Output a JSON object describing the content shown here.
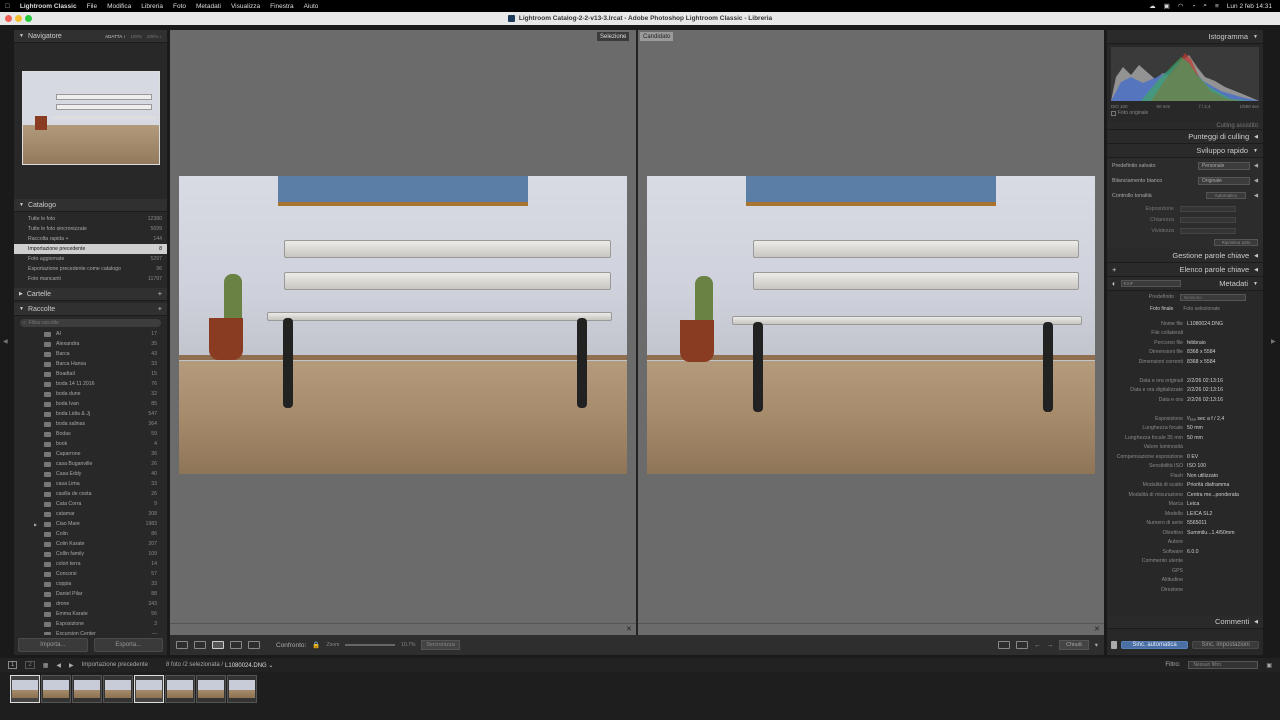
{
  "menubar": {
    "app": "Lightroom Classic",
    "items": [
      "File",
      "Modifica",
      "Libreria",
      "Foto",
      "Metadati",
      "Visualizza",
      "Finestra",
      "Aiuto"
    ],
    "clock": "Lun 2 feb  14:31"
  },
  "window": {
    "title": "Lightroom Catalog-2-2-v13-3.lrcat - Adobe Photoshop Lightroom Classic - Libreria"
  },
  "navigator": {
    "title": "Navigatore",
    "zoom": [
      "ADATTA ↕",
      "100%",
      "200% ↕"
    ]
  },
  "catalog": {
    "title": "Catalogo",
    "items": [
      {
        "label": "Tutte le foto",
        "count": "12380"
      },
      {
        "label": "Tutte le foto sincronizzate",
        "count": "5699"
      },
      {
        "label": "Raccolta rapida +",
        "count": "144"
      },
      {
        "label": "Importazione precedente",
        "count": "8"
      },
      {
        "label": "Foto aggiornate",
        "count": "5297"
      },
      {
        "label": "Esportazione precedente come catalogo",
        "count": "96"
      },
      {
        "label": "Foto mancanti",
        "count": "11797"
      }
    ]
  },
  "folders": {
    "title": "Cartelle"
  },
  "collections": {
    "title": "Raccolte",
    "search_placeholder": "Filtra raccolte",
    "items": [
      {
        "label": "AI",
        "count": "17"
      },
      {
        "label": "Alexandra",
        "count": "35"
      },
      {
        "label": "Barca",
        "count": "43"
      },
      {
        "label": "Barca Hansa",
        "count": "33"
      },
      {
        "label": "Boadtail",
        "count": "15"
      },
      {
        "label": "boda 14 11 2016",
        "count": "76"
      },
      {
        "label": "boda dune",
        "count": "32"
      },
      {
        "label": "boda Ivan",
        "count": "85"
      },
      {
        "label": "boda Lidia & Jj",
        "count": "547"
      },
      {
        "label": "boda salinas",
        "count": "364"
      },
      {
        "label": "Bodas",
        "count": "59"
      },
      {
        "label": "book",
        "count": "4"
      },
      {
        "label": "Caparrone",
        "count": "36"
      },
      {
        "label": "casa Buganville",
        "count": "26"
      },
      {
        "label": "Casa Eddy",
        "count": "40"
      },
      {
        "label": "casa Lima",
        "count": "33"
      },
      {
        "label": "casilla de costa",
        "count": "26"
      },
      {
        "label": "Cata Corra",
        "count": "9"
      },
      {
        "label": "catamar",
        "count": "308"
      },
      {
        "label": "Ciao Mare",
        "count": "1983"
      },
      {
        "label": "Colin",
        "count": "86"
      },
      {
        "label": "Colin Karate",
        "count": "207"
      },
      {
        "label": "Collin family",
        "count": "109"
      },
      {
        "label": "colori terra",
        "count": "14"
      },
      {
        "label": "Concorsi",
        "count": "57"
      },
      {
        "label": "coppia",
        "count": "33"
      },
      {
        "label": "Daniel Pilar",
        "count": "88"
      },
      {
        "label": "drone",
        "count": "343"
      },
      {
        "label": "Emma Karate",
        "count": "56"
      },
      {
        "label": "Esposizione",
        "count": "3"
      },
      {
        "label": "Excursion Center",
        "count": "—"
      }
    ]
  },
  "left_buttons": {
    "import": "Importa...",
    "export": "Esporta..."
  },
  "compare": {
    "select_label": "Selezione",
    "candidate_label": "Candidato"
  },
  "toolbar": {
    "compare_label": "Confronto:",
    "zoom_label": "Zoom",
    "zoom_value": "10.7%",
    "sync_label": "Sincronizza",
    "done_label": "Chiudi"
  },
  "histogram": {
    "title": "Istogramma",
    "iso": "ISO 100",
    "focal": "50 mm",
    "aperture": "f / 2,4",
    "shutter": "1/500 sec",
    "original_label": "Foto originale"
  },
  "right_sections": {
    "assisted": "Culling assistito",
    "culling": "Punteggi di culling",
    "quick": "Sviluppo rapido",
    "keyword_mgmt": "Gestione parole chiave",
    "keyword_list": "Elenco parole chiave",
    "metadata": "Metadati",
    "comments": "Commenti"
  },
  "quick_develop": {
    "preset_label": "Predefinito salvato",
    "preset_value": "Personale",
    "wb_label": "Bilanciamento bianco",
    "wb_value": "Originale",
    "tone_label": "Controllo tonalità",
    "tone_value": "Automatico",
    "exposure": "Esposizione",
    "clarity": "Chiarezza",
    "vibrance": "Vividezza",
    "reset": "Ripristina tutto"
  },
  "metadata_head": {
    "preset_label": "Predefinito",
    "preset_value": "Nessuno",
    "exif": "EXIF",
    "tab1": "Foto finale",
    "tab2": "Foto selezionate"
  },
  "metadata": [
    {
      "k": "Nome file",
      "v": "L1080024.DNG"
    },
    {
      "k": "File collaterali",
      "v": ""
    },
    {
      "k": "Percorso file",
      "v": "febbraio"
    },
    {
      "k": "Dimensioni file",
      "v": "8368 x 5584"
    },
    {
      "k": "Dimensioni correnti",
      "v": "8368 x 5584"
    },
    {
      "k": "",
      "v": ""
    },
    {
      "k": "Data e ora originali",
      "v": "2/2/26 02:13:16"
    },
    {
      "k": "Data e ora digitalizzate",
      "v": "2/2/26 02:13:16"
    },
    {
      "k": "Data e ora",
      "v": "2/2/26 02:13:16"
    },
    {
      "k": "",
      "v": ""
    },
    {
      "k": "Esposizione",
      "v": "¹⁄₅₀₀ sec a f / 2,4"
    },
    {
      "k": "Lunghezza focale",
      "v": "50 mm"
    },
    {
      "k": "Lunghezza focale 35 mm",
      "v": "50 mm"
    },
    {
      "k": "Valore luminosità",
      "v": ""
    },
    {
      "k": "Compensazione esposizione",
      "v": "0 EV"
    },
    {
      "k": "Sensibilità ISO",
      "v": "ISO 100"
    },
    {
      "k": "Flash",
      "v": "Non utilizzato"
    },
    {
      "k": "Modalità di scatto",
      "v": "Priorità diaframma"
    },
    {
      "k": "Modalità di misurazione",
      "v": "Centra me...ponderata"
    },
    {
      "k": "Marca",
      "v": "Leica"
    },
    {
      "k": "Modello",
      "v": "LEICA SL2"
    },
    {
      "k": "Numero di serie",
      "v": "5565011"
    },
    {
      "k": "Obiettivo",
      "v": "Summilu...1.4/50mm"
    },
    {
      "k": "Autore",
      "v": ""
    },
    {
      "k": "Software",
      "v": "6.0.0"
    },
    {
      "k": "Commento utente",
      "v": ""
    },
    {
      "k": "GPS",
      "v": ""
    },
    {
      "k": "Altitudine",
      "v": ""
    },
    {
      "k": "Direzione",
      "v": ""
    }
  ],
  "right_buttons": {
    "sync_auto": "Sinc. automatica",
    "sync_settings": "Sinc. impostazioni"
  },
  "filmstrip_bar": {
    "page1": "1",
    "page2": "2",
    "source": "Importazione precedente",
    "info": "8 foto /2 selezionata /",
    "file": "L1080024.DNG ⌄",
    "filter_label": "Filtro:",
    "filter_value": "Nessun filtro"
  },
  "colors": {
    "panel": "#282828",
    "center": "#6b6b6b",
    "selected": "#cfcfcf",
    "accent": "#4a6fa5"
  }
}
